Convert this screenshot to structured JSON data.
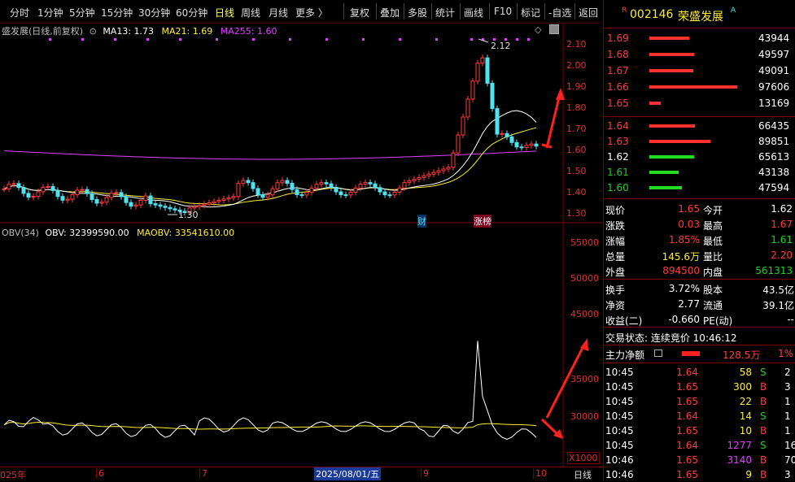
{
  "toolbar": {
    "tabs": [
      "分时",
      "1分钟",
      "5分钟",
      "15分钟",
      "30分钟",
      "60分钟",
      "日线",
      "周线",
      "月线",
      "更多 〉"
    ],
    "active": "日线",
    "buttons": [
      "复权",
      "叠加",
      "多股",
      "统计",
      "画线",
      "F10",
      "标记",
      "-自选",
      "返回"
    ]
  },
  "kline": {
    "legend_name": "盛发展(日线,前复权)",
    "ma13": "MA13: 1.73",
    "ma21": "MA21: 1.69",
    "ma255": "MA255: 1.60",
    "yticks": [
      "2.10",
      "2.00",
      "1.90",
      "1.80",
      "1.70",
      "1.60",
      "1.50",
      "1.40",
      "1.30"
    ],
    "high_label": "2.12",
    "low_label": "1.30",
    "tag_cai": "财",
    "tag_zhangbang": "涨榜",
    "colors": {
      "ma13": "#ffffff",
      "ma21": "#ffee33",
      "ma255": "#e040ff",
      "up": "#ff3b3b",
      "down": "#4fe2f0"
    }
  },
  "obv": {
    "legend_name": "OBV(34)",
    "obv_value": "OBV: 32399590.00",
    "maobv_value": "MAOBV: 33541610.00",
    "yticks": [
      "55000",
      "50000",
      "45000",
      "35000",
      "30000"
    ],
    "unit": "X1000"
  },
  "xaxis": {
    "labels": [
      "025年",
      "6",
      "7",
      "2025/08/01/五",
      "9",
      "10"
    ],
    "period": "日线"
  },
  "quote": {
    "market_tag": "R",
    "code": "002146",
    "name": "荣盛发展",
    "name_suffix": "A",
    "asks": [
      {
        "price": "1.69",
        "vol": "43944",
        "bar": 0.45
      },
      {
        "price": "1.68",
        "vol": "49597",
        "bar": 0.51
      },
      {
        "price": "1.67",
        "vol": "49091",
        "bar": 0.5
      },
      {
        "price": "1.66",
        "vol": "97606",
        "bar": 1.0
      },
      {
        "price": "1.65",
        "vol": "13169",
        "bar": 0.13
      }
    ],
    "bids": [
      {
        "price": "1.64",
        "vol": "66435",
        "bar": 0.74
      },
      {
        "price": "1.63",
        "vol": "89851",
        "bar": 1.0
      },
      {
        "price": "1.62",
        "vol": "65613",
        "bar": 0.73
      },
      {
        "price": "1.61",
        "vol": "43138",
        "bar": 0.48
      },
      {
        "price": "1.60",
        "vol": "47594",
        "bar": 0.53
      }
    ],
    "stats": [
      {
        "l1": "现价",
        "v1": "1.65",
        "c1": "red",
        "l2": "今开",
        "v2": "1.62",
        "c2": "white"
      },
      {
        "l1": "涨跌",
        "v1": "0.03",
        "c1": "red",
        "l2": "最高",
        "v2": "1.67",
        "c2": "red"
      },
      {
        "l1": "涨幅",
        "v1": "1.85%",
        "c1": "red",
        "l2": "最低",
        "v2": "1.61",
        "c2": "green"
      },
      {
        "l1": "总量",
        "v1": "145.6万",
        "c1": "yellow",
        "l2": "量比",
        "v2": "2.20",
        "c2": "red"
      },
      {
        "l1": "外盘",
        "v1": "894500",
        "c1": "red",
        "l2": "内盘",
        "v2": "561313",
        "c2": "green"
      }
    ],
    "stats2": [
      {
        "l1": "换手",
        "v1": "3.72%",
        "l2": "股本",
        "v2": "43.5亿"
      },
      {
        "l1": "净资",
        "v1": "2.77",
        "l2": "流通",
        "v2": "39.1亿"
      },
      {
        "l1": "收益(二)",
        "v1": "-0.660",
        "l2": "PE(动)",
        "v2": "--"
      }
    ],
    "trade_status": "交易状态: 连续竞价 10:46:12",
    "main_net_label": "主力净额",
    "main_net_value": "128.5万",
    "main_net_pct": "1%",
    "ticks": [
      {
        "t": "10:45",
        "p": "1.64",
        "v": "58",
        "s": "S",
        "n": "2",
        "pc": "red",
        "vc": "yellow"
      },
      {
        "t": "10:45",
        "p": "1.65",
        "v": "300",
        "s": "B",
        "n": "3",
        "pc": "red",
        "vc": "yellow"
      },
      {
        "t": "10:45",
        "p": "1.65",
        "v": "22",
        "s": "B",
        "n": "1",
        "pc": "red",
        "vc": "yellow"
      },
      {
        "t": "10:45",
        "p": "1.64",
        "v": "14",
        "s": "S",
        "n": "1",
        "pc": "red",
        "vc": "yellow"
      },
      {
        "t": "10:45",
        "p": "1.65",
        "v": "10",
        "s": "B",
        "n": "1",
        "pc": "red",
        "vc": "yellow"
      },
      {
        "t": "10:45",
        "p": "1.64",
        "v": "1277",
        "s": "S",
        "n": "16",
        "pc": "red",
        "vc": "magenta"
      },
      {
        "t": "10:46",
        "p": "1.65",
        "v": "3140",
        "s": "B",
        "n": "70",
        "pc": "red",
        "vc": "magenta"
      },
      {
        "t": "10:46",
        "p": "1.65",
        "v": "9",
        "s": "B",
        "n": "3",
        "pc": "red",
        "vc": "yellow"
      }
    ]
  }
}
